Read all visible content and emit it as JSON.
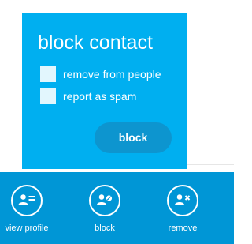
{
  "dialog": {
    "title": "block contact",
    "options": [
      {
        "label": "remove from people",
        "checked": false
      },
      {
        "label": "report as spam",
        "checked": false
      }
    ],
    "confirm_label": "block"
  },
  "toolbar": {
    "actions": [
      {
        "label": "view profile",
        "icon": "profile-card-icon"
      },
      {
        "label": "block",
        "icon": "block-user-icon"
      },
      {
        "label": "remove",
        "icon": "remove-user-icon"
      }
    ]
  },
  "colors": {
    "dialog_background": "#00aff0",
    "button_background": "#0d95cf",
    "toolbar_background": "#0096d6",
    "checkbox_fill": "#e2f6fd",
    "text": "#ffffff"
  }
}
